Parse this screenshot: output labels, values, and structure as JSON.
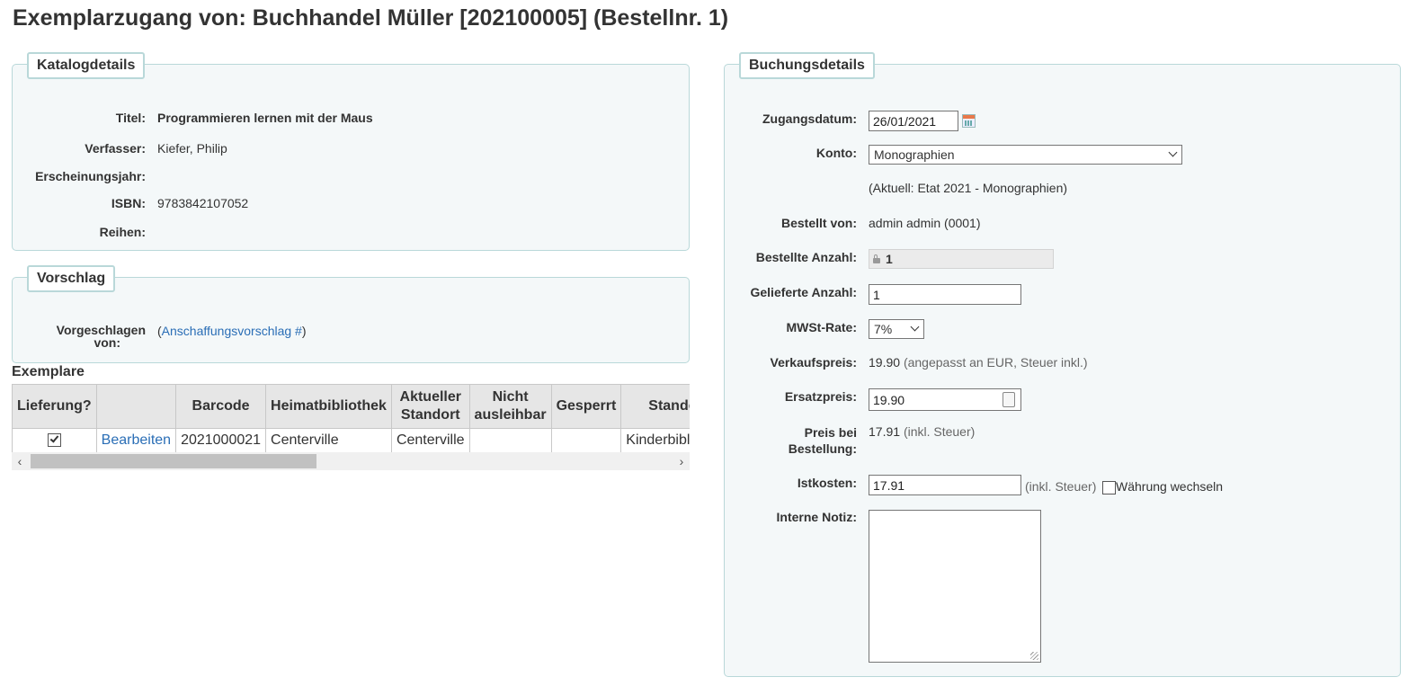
{
  "page_title": "Exemplarzugang von: Buchhandel Müller [202100005] (Bestellnr. 1)",
  "catalog": {
    "legend": "Katalogdetails",
    "fields": [
      {
        "label": "Titel:",
        "value": "Programmieren lernen mit der Maus",
        "bold": true
      },
      {
        "label": "Verfasser:",
        "value": "Kiefer, Philip"
      },
      {
        "label": "Erscheinungsjahr:",
        "value": ""
      },
      {
        "label": "ISBN:",
        "value": "9783842107052"
      },
      {
        "label": "Reihen:",
        "value": ""
      }
    ]
  },
  "suggestion": {
    "legend": "Vorschlag",
    "label_line1": "Vorgeschlagen",
    "label_line2": "von:",
    "paren_open": "(",
    "link_text": "Anschaffungsvorschlag #",
    "paren_close": ")"
  },
  "items": {
    "heading": "Exemplare",
    "columns": [
      "Lieferung?",
      "",
      "Barcode",
      "Heimatbibliothek",
      "Aktueller Standort",
      "Nicht ausleihbar",
      "Gesperrt",
      "Standort"
    ],
    "rows": [
      {
        "received": true,
        "edit_label": "Bearbeiten",
        "barcode": "2021000021",
        "homebranch": "Centerville",
        "holdingbranch": "Centerville",
        "notforloan": "",
        "withdrawn": "",
        "location": "Kinderbibliothek"
      }
    ]
  },
  "booking": {
    "legend": "Buchungsdetails",
    "receive_date_label": "Zugangsdatum:",
    "receive_date": "26/01/2021",
    "fund_label": "Konto:",
    "fund_selected": "Monographien",
    "fund_current": "(Aktuell: Etat 2021 - Monographien)",
    "ordered_by_label": "Bestellt von:",
    "ordered_by": "admin admin (0001)",
    "ordered_qty_label": "Bestellte Anzahl:",
    "ordered_qty": "1",
    "received_qty_label": "Gelieferte Anzahl:",
    "received_qty": "1",
    "tax_label": "MWSt-Rate:",
    "tax_selected": "7%",
    "retail_label": "Verkaufspreis:",
    "retail_value": "19.90",
    "retail_note": "(angepasst an EUR, Steuer inkl.)",
    "replacement_label": "Ersatzpreis:",
    "replacement_value": "19.90",
    "order_price_label_1": "Preis bei",
    "order_price_label_2": "Bestellung:",
    "order_price_value": "17.91",
    "order_price_note": "(inkl. Steuer)",
    "actual_cost_label": "Istkosten:",
    "actual_cost_value": "17.91",
    "actual_cost_note": "(inkl. Steuer)",
    "change_currency_label": "Währung wechseln",
    "internal_note_label": "Interne Notiz:",
    "internal_note_value": ""
  },
  "colors": {
    "fieldset_bg": "#f4f8f9",
    "fieldset_border": "#b9d8d9",
    "link": "#2a6eb6"
  }
}
